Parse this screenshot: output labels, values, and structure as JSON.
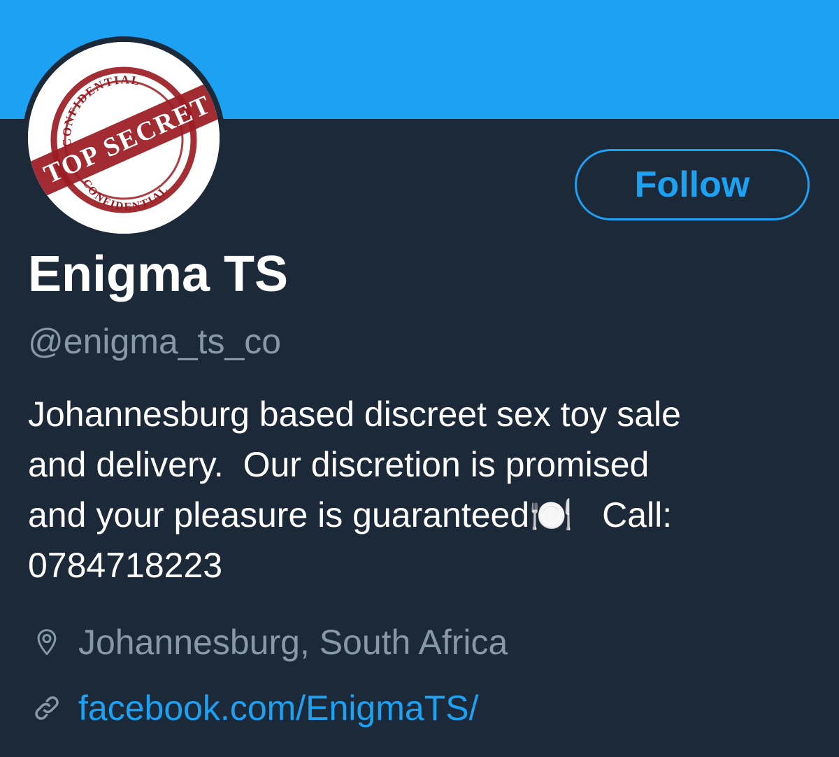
{
  "profile": {
    "display_name": "Enigma TS",
    "handle": "@enigma_ts_co",
    "bio_lines": [
      "Johannesburg based discreet sex toy sale",
      "and delivery.  Our discretion is promised",
      "and your pleasure is guaranteed🍽️   Call:",
      "0784718223"
    ],
    "location": "Johannesburg, South Africa",
    "website": "facebook.com/EnigmaTS/"
  },
  "avatar_stamp": {
    "top_text": "CONFIDENTIAL",
    "bottom_text": "CONFIDENTIAL",
    "band_text": "TOP SECRET"
  },
  "actions": {
    "follow_label": "Follow"
  },
  "icons": {
    "location": "map-pin-icon",
    "website": "link-icon"
  },
  "colors": {
    "banner": "#1da1f2",
    "background": "#1c2938",
    "accent": "#1da1f2",
    "secondary_text": "#8899a6",
    "stamp_red": "#9b1c22"
  }
}
